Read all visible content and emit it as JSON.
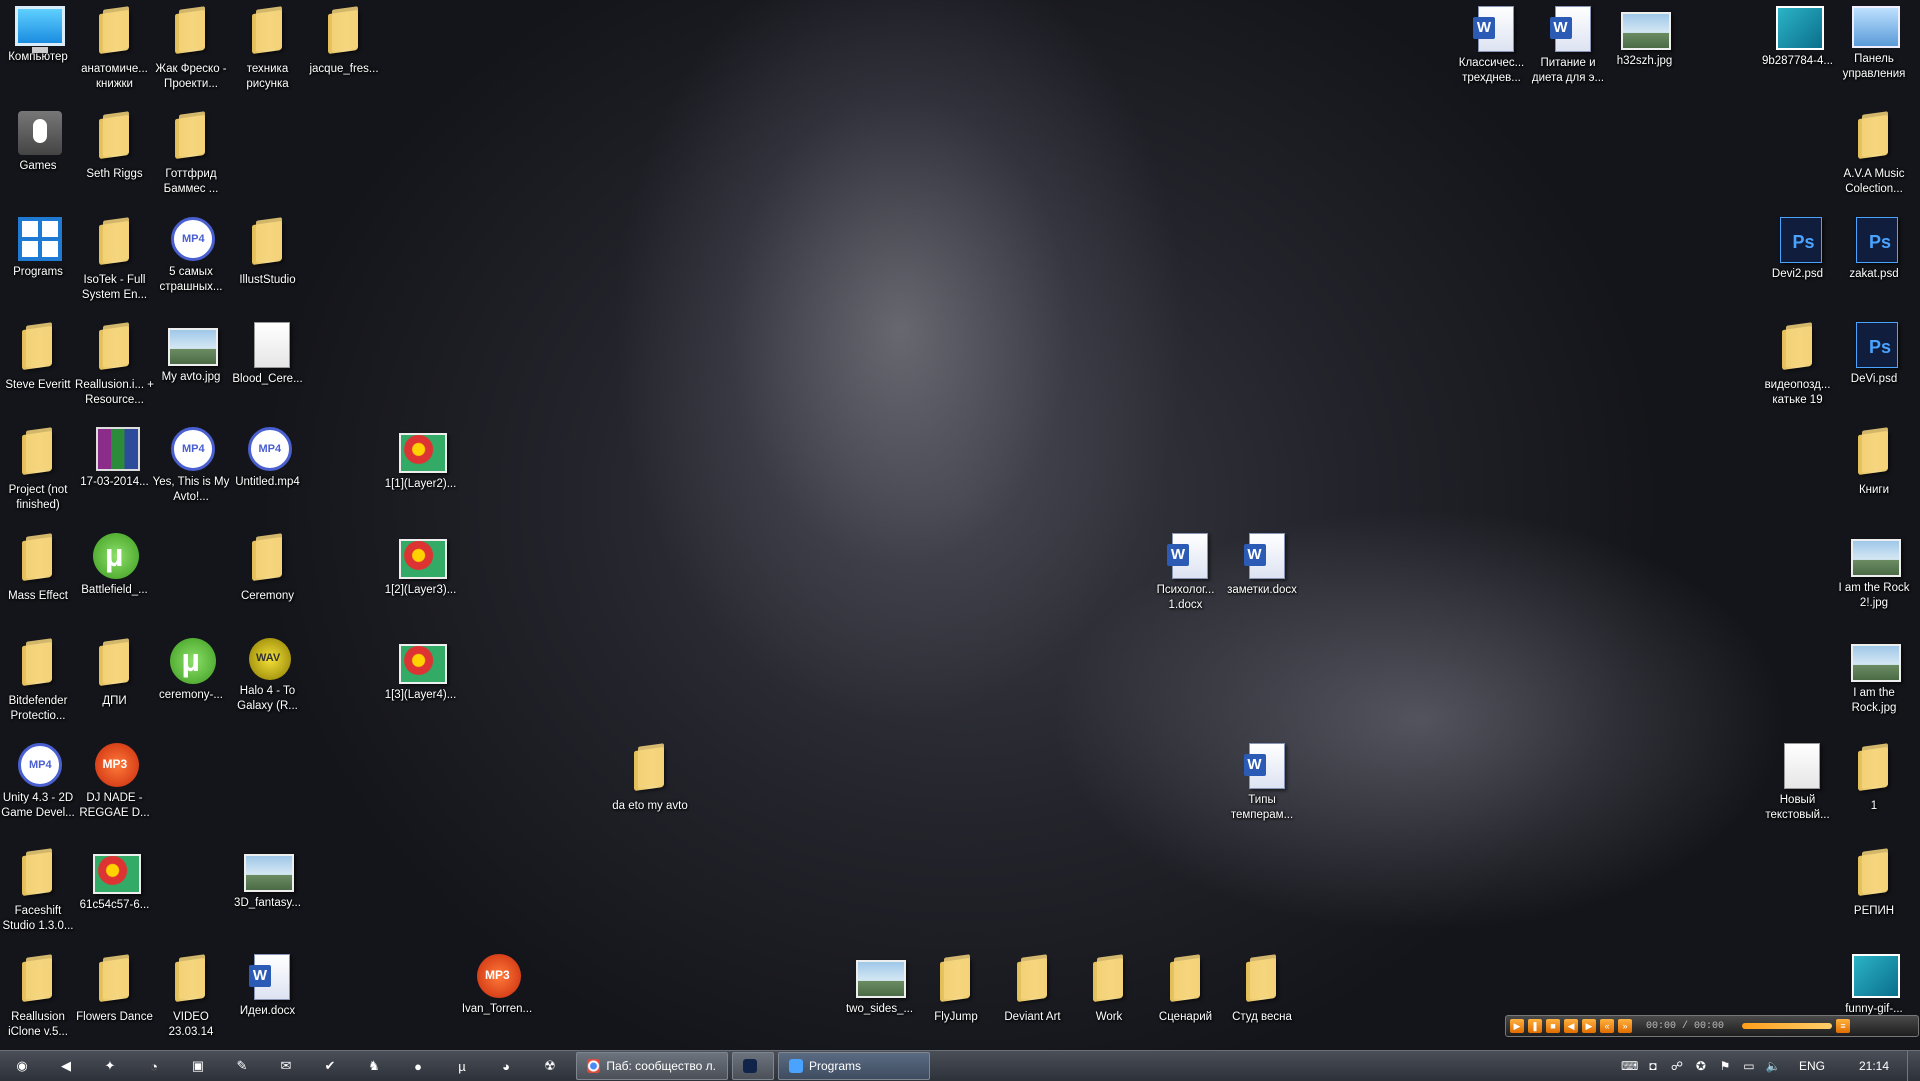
{
  "desktop_icons": [
    {
      "label": "Компьютер",
      "icon": "computer-icon",
      "kind": "computer",
      "col": 0,
      "row": 0
    },
    {
      "label": "анатомиче... книжки",
      "icon": "folder-icon",
      "kind": "folder",
      "col": 1,
      "row": 0
    },
    {
      "label": "Жак Фреско - Проекти...",
      "icon": "folder-icon",
      "kind": "folder",
      "col": 2,
      "row": 0
    },
    {
      "label": "техника рисунка",
      "icon": "folder-icon",
      "kind": "folder",
      "col": 3,
      "row": 0
    },
    {
      "label": "jacque_fres...",
      "icon": "folder-icon",
      "kind": "folder",
      "col": 4,
      "row": 0
    },
    {
      "label": "Games",
      "icon": "mouse-icon",
      "kind": "games",
      "col": 0,
      "row": 1
    },
    {
      "label": "Seth Riggs",
      "icon": "folder-icon",
      "kind": "folder",
      "col": 1,
      "row": 1
    },
    {
      "label": "Готтфрид Баммес ...",
      "icon": "folder-icon",
      "kind": "folder",
      "col": 2,
      "row": 1
    },
    {
      "label": "Programs",
      "icon": "windows-icon",
      "kind": "programs",
      "col": 0,
      "row": 2
    },
    {
      "label": "IsoTek - Full System En...",
      "icon": "folder-icon",
      "kind": "folder",
      "col": 1,
      "row": 2
    },
    {
      "label": "5 самых страшных...",
      "icon": "mp4-file-icon",
      "kind": "mp4",
      "col": 2,
      "row": 2
    },
    {
      "label": "IllustStudio",
      "icon": "folder-icon",
      "kind": "folder",
      "col": 3,
      "row": 2
    },
    {
      "label": "Steve Everitt",
      "icon": "folder-icon",
      "kind": "folder",
      "col": 0,
      "row": 3
    },
    {
      "label": "Reallusion.i... + Resource...",
      "icon": "folder-icon",
      "kind": "folder",
      "col": 1,
      "row": 3
    },
    {
      "label": "My avto.jpg",
      "icon": "image-file-icon",
      "kind": "img",
      "col": 2,
      "row": 3
    },
    {
      "label": "Blood_Cere...",
      "icon": "blank-file-icon",
      "kind": "doc",
      "col": 3,
      "row": 3
    },
    {
      "label": "Project (not finished)",
      "icon": "folder-icon",
      "kind": "folder",
      "col": 0,
      "row": 4
    },
    {
      "label": "17-03-2014...",
      "icon": "winrar-icon",
      "kind": "winrar",
      "col": 1,
      "row": 4
    },
    {
      "label": "Yes, This is My Avto!...",
      "icon": "mp4-file-icon",
      "kind": "mp4",
      "col": 2,
      "row": 4
    },
    {
      "label": "Untitled.mp4",
      "icon": "mp4-file-icon",
      "kind": "mp4",
      "col": 3,
      "row": 4
    },
    {
      "label": "1[1](Layer2)...",
      "icon": "flower-image-icon",
      "kind": "flower",
      "col": 5,
      "row": 4
    },
    {
      "label": "Mass Effect",
      "icon": "folder-icon",
      "kind": "folder",
      "col": 0,
      "row": 5
    },
    {
      "label": "Battlefield_...",
      "icon": "utorrent-icon",
      "kind": "utor",
      "col": 1,
      "row": 5
    },
    {
      "label": "Ceremony",
      "icon": "folder-icon",
      "kind": "folder",
      "col": 3,
      "row": 5
    },
    {
      "label": "1[2](Layer3)...",
      "icon": "flower-image-icon",
      "kind": "flower",
      "col": 5,
      "row": 5
    },
    {
      "label": "Bitdefender Protectio...",
      "icon": "folder-icon",
      "kind": "folder",
      "col": 0,
      "row": 6
    },
    {
      "label": "ДПИ",
      "icon": "folder-icon",
      "kind": "folder",
      "col": 1,
      "row": 6
    },
    {
      "label": "ceremony-...",
      "icon": "utorrent-icon",
      "kind": "utor",
      "col": 2,
      "row": 6
    },
    {
      "label": "Halo 4 - To Galaxy (R...",
      "icon": "wav-file-icon",
      "kind": "wav",
      "col": 3,
      "row": 6
    },
    {
      "label": "1[3](Layer4)...",
      "icon": "flower-image-icon",
      "kind": "flower",
      "col": 5,
      "row": 6
    },
    {
      "label": "Unity 4.3 - 2D Game Devel...",
      "icon": "mp4-file-icon",
      "kind": "mp4",
      "col": 0,
      "row": 7
    },
    {
      "label": "DJ NADE - REGGAE D...",
      "icon": "mp3-file-icon",
      "kind": "mp3",
      "col": 1,
      "row": 7
    },
    {
      "label": "Faceshift Studio 1.3.0...",
      "icon": "folder-icon",
      "kind": "folder",
      "col": 0,
      "row": 8
    },
    {
      "label": "61c54c57-6...",
      "icon": "flower-image-icon",
      "kind": "flower",
      "col": 1,
      "row": 8
    },
    {
      "label": "3D_fantasy...",
      "icon": "image-file-icon",
      "kind": "img",
      "col": 3,
      "row": 8
    },
    {
      "label": "Reallusion iClone v.5...",
      "icon": "folder-icon",
      "kind": "folder",
      "col": 0,
      "row": 9
    },
    {
      "label": "Flowers Dance",
      "icon": "folder-icon",
      "kind": "folder",
      "col": 1,
      "row": 9
    },
    {
      "label": "VIDEO 23.03.14",
      "icon": "folder-icon",
      "kind": "folder",
      "col": 2,
      "row": 9
    },
    {
      "label": "Идеи.docx",
      "icon": "word-doc-icon",
      "kind": "word",
      "col": 3,
      "row": 9
    },
    {
      "label": "Ivan_Torren...",
      "icon": "mp3-file-icon",
      "kind": "mp3",
      "col": 6,
      "row": 9
    },
    {
      "label": "da eto my avto",
      "icon": "folder-icon",
      "kind": "folder",
      "col": 8,
      "row": 7
    },
    {
      "label": "Психолог... 1.docx",
      "icon": "word-doc-icon",
      "kind": "word",
      "col": 15,
      "row": 5
    },
    {
      "label": "заметки.docx",
      "icon": "word-doc-icon",
      "kind": "word",
      "col": 16,
      "row": 5
    },
    {
      "label": "Типы темперам...",
      "icon": "word-doc-icon",
      "kind": "word",
      "col": 16,
      "row": 7
    },
    {
      "label": "two_sides_...",
      "icon": "image-file-icon",
      "kind": "img",
      "col": 11,
      "row": 9
    },
    {
      "label": "FlyJump",
      "icon": "folder-icon",
      "kind": "folder",
      "col": 12,
      "row": 9
    },
    {
      "label": "Deviant Art",
      "icon": "folder-icon",
      "kind": "folder",
      "col": 13,
      "row": 9
    },
    {
      "label": "Work",
      "icon": "folder-icon",
      "kind": "folder",
      "col": 14,
      "row": 9
    },
    {
      "label": "Сценарий",
      "icon": "folder-icon",
      "kind": "folder",
      "col": 15,
      "row": 9
    },
    {
      "label": "Студ весна",
      "icon": "folder-icon",
      "kind": "folder",
      "col": 16,
      "row": 9
    },
    {
      "label": "Классичес... трехднев...",
      "icon": "word-doc-icon",
      "kind": "word",
      "col": 19,
      "row": 0
    },
    {
      "label": "Питание и диета для э...",
      "icon": "word-doc-icon",
      "kind": "word",
      "col": 20,
      "row": 0
    },
    {
      "label": "h32szh.jpg",
      "icon": "image-file-icon",
      "kind": "img",
      "col": 21,
      "row": 0
    },
    {
      "label": "9b287784-4...",
      "icon": "photo-viewer-icon",
      "kind": "photo",
      "col": 23,
      "row": 0
    },
    {
      "label": "Панель управления",
      "icon": "control-panel-icon",
      "kind": "panel",
      "col": 24,
      "row": 0
    },
    {
      "label": "A.V.A Music Colection...",
      "icon": "folder-icon",
      "kind": "folder",
      "col": 24,
      "row": 1
    },
    {
      "label": "Devi2.psd",
      "icon": "psd-file-icon",
      "kind": "psd",
      "col": 23,
      "row": 2
    },
    {
      "label": "zakat.psd",
      "icon": "psd-file-icon",
      "kind": "psd",
      "col": 24,
      "row": 2
    },
    {
      "label": "видеопозд... катьке 19",
      "icon": "folder-icon",
      "kind": "folder",
      "col": 23,
      "row": 3
    },
    {
      "label": "DeVi.psd",
      "icon": "psd-file-icon",
      "kind": "psd",
      "col": 24,
      "row": 3
    },
    {
      "label": "Книги",
      "icon": "folder-icon",
      "kind": "folder",
      "col": 24,
      "row": 4
    },
    {
      "label": "I am the Rock 2!.jpg",
      "icon": "image-file-icon",
      "kind": "img",
      "col": 24,
      "row": 5
    },
    {
      "label": "I am the Rock.jpg",
      "icon": "image-file-icon",
      "kind": "img",
      "col": 24,
      "row": 6
    },
    {
      "label": "Новый текстовый...",
      "icon": "text-file-icon",
      "kind": "doc",
      "col": 23,
      "row": 7
    },
    {
      "label": "1",
      "icon": "folder-icon",
      "kind": "folder",
      "col": 24,
      "row": 7
    },
    {
      "label": "РЕПИН",
      "icon": "folder-icon",
      "kind": "folder",
      "col": 24,
      "row": 8
    },
    {
      "label": "funny-gif-...",
      "icon": "photo-viewer-icon",
      "kind": "photo",
      "col": 24,
      "row": 9
    }
  ],
  "media_player": {
    "time": "00:00 / 00:00",
    "volume_fraction": 0.85
  },
  "taskbar": {
    "pinned": [
      {
        "name": "start-button-icon",
        "glyph": "◉"
      },
      {
        "name": "speaker-app-icon",
        "glyph": "◀"
      },
      {
        "name": "app-icon-1",
        "glyph": "✦"
      },
      {
        "name": "app-icon-2",
        "glyph": "◔"
      },
      {
        "name": "app-icon-3",
        "glyph": "▣"
      },
      {
        "name": "app-icon-4",
        "glyph": "✎"
      },
      {
        "name": "app-icon-5",
        "glyph": "✉"
      },
      {
        "name": "app-icon-6",
        "glyph": "✔"
      },
      {
        "name": "app-icon-7",
        "glyph": "♞"
      },
      {
        "name": "app-icon-8",
        "glyph": "●"
      },
      {
        "name": "utorrent-taskbar-icon",
        "glyph": "µ"
      },
      {
        "name": "app-icon-9",
        "glyph": "◕"
      },
      {
        "name": "app-icon-10",
        "glyph": "☢"
      }
    ],
    "tasks": [
      {
        "label": "Паб: сообщество л...",
        "icon": "chrome-icon"
      },
      {
        "label": "",
        "icon": "photoshop-icon"
      },
      {
        "label": "Programs",
        "icon": "folder-window-icon"
      }
    ],
    "tray": {
      "language": "ENG",
      "clock": "21:14"
    }
  }
}
